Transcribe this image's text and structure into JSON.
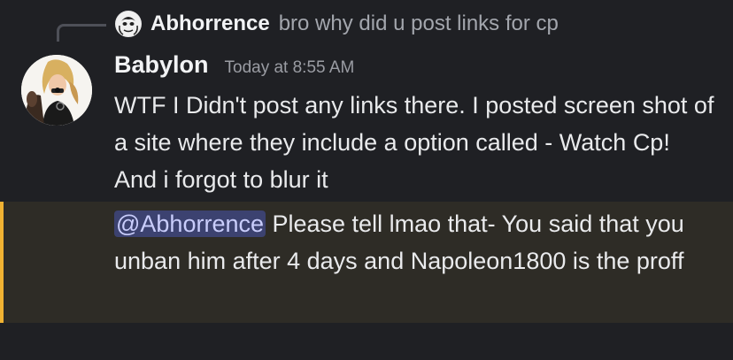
{
  "reply": {
    "author": "Abhorrence",
    "text": "bro why did u post links for cp"
  },
  "message": {
    "author": "Babylon",
    "timestamp": "Today at 8:55 AM",
    "text": "WTF I Didn't post any links there. I posted screen shot of a site where they include a option called - Watch Cp! And i forgot to blur it"
  },
  "followup": {
    "mention": "@Abhorrence",
    "text": " Please tell lmao that- You said that you unban him after 4 days and Napoleon1800 is the proff"
  },
  "colors": {
    "background": "#1f2024",
    "mention_highlight": "#2e2c26",
    "mention_stripe": "#f0b232",
    "mention_pill": "#3c4270"
  },
  "icons": {
    "reply_avatar": "avatar-icon",
    "author_avatar": "avatar"
  }
}
